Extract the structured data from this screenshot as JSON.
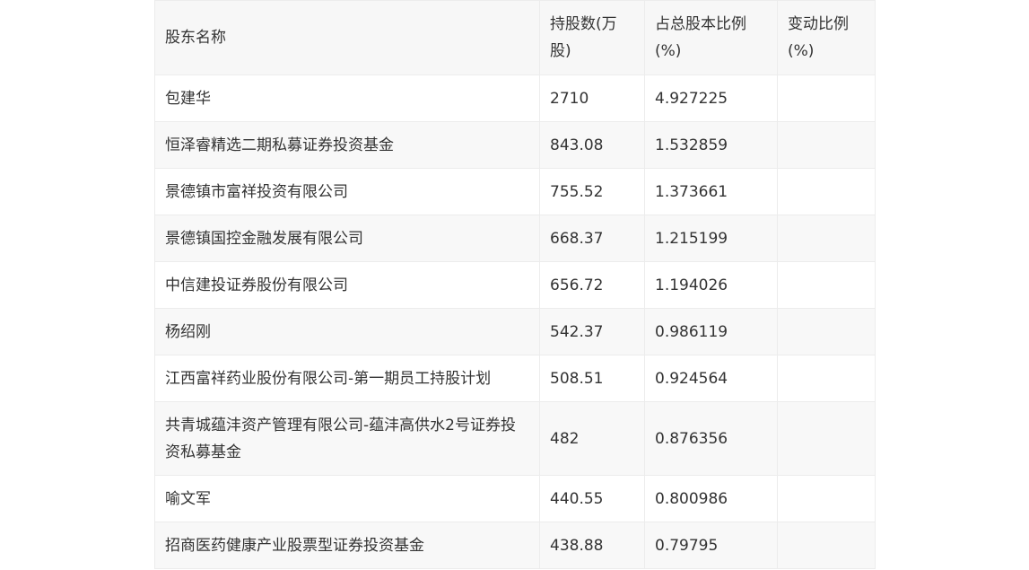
{
  "table": {
    "headers": [
      "股东名称",
      "持股数(万股)",
      "占总股本比例(%)",
      "变动比例(%)"
    ],
    "rows": [
      {
        "name": "包建华",
        "shares": "2710",
        "ratio": "4.927225",
        "change": ""
      },
      {
        "name": "恒泽睿精选二期私募证券投资基金",
        "shares": "843.08",
        "ratio": "1.532859",
        "change": ""
      },
      {
        "name": "景德镇市富祥投资有限公司",
        "shares": "755.52",
        "ratio": "1.373661",
        "change": ""
      },
      {
        "name": "景德镇国控金融发展有限公司",
        "shares": "668.37",
        "ratio": "1.215199",
        "change": ""
      },
      {
        "name": "中信建投证券股份有限公司",
        "shares": "656.72",
        "ratio": "1.194026",
        "change": ""
      },
      {
        "name": "杨绍刚",
        "shares": "542.37",
        "ratio": "0.986119",
        "change": ""
      },
      {
        "name": "江西富祥药业股份有限公司-第一期员工持股计划",
        "shares": "508.51",
        "ratio": "0.924564",
        "change": ""
      },
      {
        "name": "共青城蕴沣资产管理有限公司-蕴沣高供水2号证券投资私募基金",
        "shares": "482",
        "ratio": "0.876356",
        "change": ""
      },
      {
        "name": "喻文军",
        "shares": "440.55",
        "ratio": "0.800986",
        "change": ""
      },
      {
        "name": "招商医药健康产业股票型证券投资基金",
        "shares": "438.88",
        "ratio": "0.79795",
        "change": ""
      }
    ]
  }
}
